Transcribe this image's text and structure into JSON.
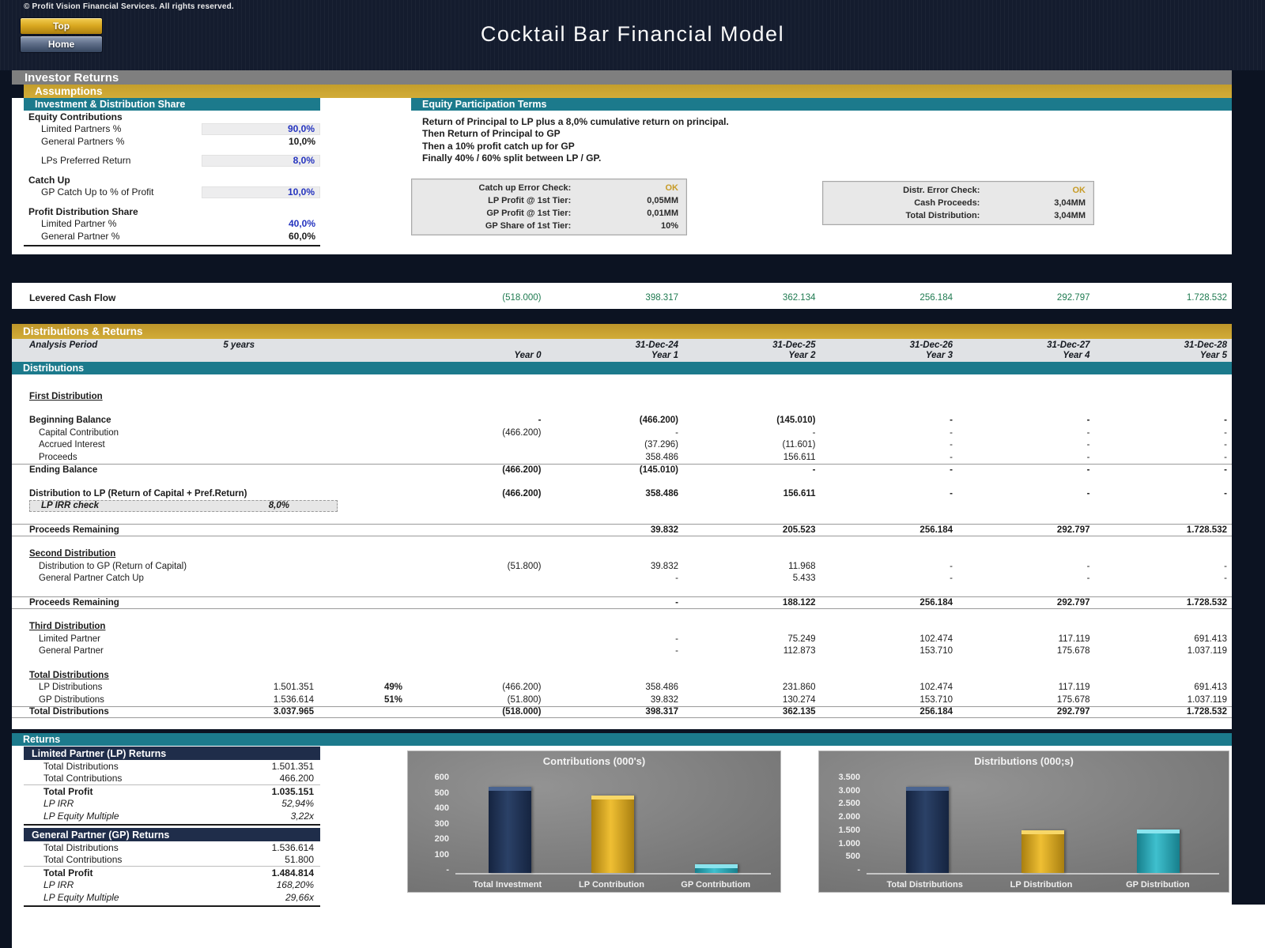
{
  "header": {
    "copyright": "© Profit Vision Financial Services. All rights reserved.",
    "top_button": "Top",
    "home_button": "Home",
    "title": "Cocktail Bar Financial Model"
  },
  "bars": {
    "investor_returns": "Investor Returns",
    "assumptions": "Assumptions",
    "distributions_returns": "Distributions & Returns",
    "distributions": "Distributions",
    "returns": "Returns"
  },
  "investment_share": {
    "title": "Investment & Distribution Share",
    "headings": [
      "Equity Contributions",
      "Catch Up",
      "Profit Distribution Share"
    ],
    "rows": [
      {
        "label": "Limited Partners %",
        "value": "90,0%"
      },
      {
        "label": "General Partners %",
        "value": "10,0%"
      },
      {
        "label": "LPs Preferred Return",
        "value": "8,0%"
      },
      {
        "label": "GP Catch Up to % of Profit",
        "value": "10,0%"
      },
      {
        "label": "Limited Partner %",
        "value": "40,0%"
      },
      {
        "label": "General Partner %",
        "value": "60,0%"
      }
    ]
  },
  "equity_terms": {
    "title": "Equity Participation Terms",
    "lines": [
      "Return of Principal to LP plus a 8,0% cumulative return on principal.",
      "Then Return of Principal to GP",
      "Then a 10% profit catch up for GP",
      "Finally 40% / 60% split between LP / GP."
    ],
    "catchup_check": {
      "rows": [
        {
          "label": "Catch up Error Check:",
          "value": "OK"
        },
        {
          "label": "LP Profit @ 1st Tier:",
          "value": "0,05MM"
        },
        {
          "label": "GP Profit @ 1st Tier:",
          "value": "0,01MM"
        },
        {
          "label": "GP Share of 1st Tier:",
          "value": "10%"
        }
      ]
    },
    "distr_check": {
      "rows": [
        {
          "label": "Distr. Error Check:",
          "value": "OK"
        },
        {
          "label": "Cash Proceeds:",
          "value": "3,04MM"
        },
        {
          "label": "Total Distribution:",
          "value": "3,04MM"
        }
      ]
    }
  },
  "levered": {
    "label": "Levered Cash Flow",
    "values": [
      "(518.000)",
      "398.317",
      "362.134",
      "256.184",
      "292.797",
      "1.728.532"
    ]
  },
  "periods": {
    "analysis_label": "Analysis Period",
    "analysis_value": "5 years",
    "dates": [
      "31-Dec-24",
      "31-Dec-25",
      "31-Dec-26",
      "31-Dec-27",
      "31-Dec-28"
    ],
    "year_labels": [
      "Year 0",
      "Year 1",
      "Year 2",
      "Year 3",
      "Year 4",
      "Year 5"
    ]
  },
  "dist_table": {
    "rows": [
      {
        "type": "spacer",
        "lg": true
      },
      {
        "label": "First Distribution",
        "b": true,
        "u": true
      },
      {
        "type": "spacer"
      },
      {
        "label": "Beginning Balance",
        "b": true,
        "v": [
          "-",
          "(466.200)",
          "(145.010)",
          "-",
          "-",
          "-"
        ]
      },
      {
        "label": "Capital Contribution",
        "i": true,
        "v": [
          "(466.200)",
          "-",
          "-",
          "-",
          "-",
          "-"
        ]
      },
      {
        "label": "Accrued Interest",
        "i": true,
        "v": [
          "",
          "(37.296)",
          "(11.601)",
          "-",
          "-",
          "-"
        ]
      },
      {
        "label": "Proceeds",
        "i": true,
        "v": [
          "",
          "358.486",
          "156.611",
          "-",
          "-",
          "-"
        ]
      },
      {
        "label": "Ending Balance",
        "b": true,
        "border": "top",
        "v": [
          "(466.200)",
          "(145.010)",
          "-",
          "-",
          "-",
          "-"
        ]
      },
      {
        "type": "spacer"
      },
      {
        "label": "Distribution to LP (Return of Capital + Pref.Return)",
        "b": true,
        "v": [
          "(466.200)",
          "358.486",
          "156.611",
          "-",
          "-",
          "-"
        ]
      },
      {
        "label": "LP IRR check",
        "irr": true,
        "pct": "8,0%"
      },
      {
        "type": "spacer"
      },
      {
        "label": "Proceeds Remaining",
        "b": true,
        "border": "both",
        "v": [
          "",
          "39.832",
          "205.523",
          "256.184",
          "292.797",
          "1.728.532"
        ]
      },
      {
        "type": "spacer"
      },
      {
        "label": "Second Distribution",
        "b": true,
        "u": true
      },
      {
        "label": "Distribution to GP (Return of Capital)",
        "i": true,
        "v": [
          "(51.800)",
          "39.832",
          "11.968",
          "-",
          "-",
          "-"
        ]
      },
      {
        "label": "General Partner Catch Up",
        "i": true,
        "v": [
          "",
          "-",
          "5.433",
          "-",
          "-",
          "-"
        ]
      },
      {
        "type": "spacer"
      },
      {
        "label": "Proceeds Remaining",
        "b": true,
        "border": "both",
        "v": [
          "",
          "-",
          "188.122",
          "256.184",
          "292.797",
          "1.728.532"
        ]
      },
      {
        "type": "spacer"
      },
      {
        "label": "Third Distribution",
        "b": true,
        "u": true
      },
      {
        "label": "Limited Partner",
        "i": true,
        "v": [
          "",
          "-",
          "75.249",
          "102.474",
          "117.119",
          "691.413"
        ]
      },
      {
        "label": "General Partner",
        "i": true,
        "v": [
          "",
          "-",
          "112.873",
          "153.710",
          "175.678",
          "1.037.119"
        ]
      },
      {
        "type": "spacer"
      },
      {
        "label": "Total Distributions",
        "b": true,
        "u": true
      },
      {
        "label": "LP Distributions",
        "i": true,
        "total": "1.501.351",
        "pct": "49%",
        "v": [
          "(466.200)",
          "358.486",
          "231.860",
          "102.474",
          "117.119",
          "691.413"
        ]
      },
      {
        "label": "GP Distributions",
        "i": true,
        "total": "1.536.614",
        "pct": "51%",
        "v": [
          "(51.800)",
          "39.832",
          "130.274",
          "153.710",
          "175.678",
          "1.037.119"
        ]
      },
      {
        "label": "Total Distributions",
        "b": true,
        "total": "3.037.965",
        "border": "both",
        "v": [
          "(518.000)",
          "398.317",
          "362.135",
          "256.184",
          "292.797",
          "1.728.532"
        ]
      }
    ]
  },
  "returns_panels": {
    "lp": {
      "title": "Limited Partner (LP) Returns",
      "rows": [
        {
          "label": "Total Distributions",
          "value": "1.501.351"
        },
        {
          "label": "Total Contributions",
          "value": "466.200"
        },
        {
          "label": "Total Profit",
          "value": "1.035.151"
        },
        {
          "label": "LP IRR",
          "value": "52,94%"
        },
        {
          "label": "LP Equity Multiple",
          "value": "3,22x"
        }
      ]
    },
    "gp": {
      "title": "General Partner (GP) Returns",
      "rows": [
        {
          "label": "Total Distributions",
          "value": "1.536.614"
        },
        {
          "label": "Total Contributions",
          "value": "51.800"
        },
        {
          "label": "Total Profit",
          "value": "1.484.814"
        },
        {
          "label": "LP IRR",
          "value": "168,20%"
        },
        {
          "label": "LP Equity Multiple",
          "value": "29,66x"
        }
      ]
    }
  },
  "chart_data": [
    {
      "type": "bar",
      "title": "Contributions (000's)",
      "categories": [
        "Total Investment",
        "LP Contribution",
        "GP Contributiom"
      ],
      "values": [
        518,
        466,
        52
      ],
      "ylim": [
        0,
        600
      ],
      "yticks": [
        "600",
        "500",
        "400",
        "300",
        "200",
        "100",
        "-"
      ],
      "bar_colors": [
        {
          "main": "#2B4167",
          "edge": "#152440",
          "lid": "#4A6490"
        },
        {
          "main": "#EFBF33",
          "edge": "#A97F10",
          "lid": "#F7D768"
        },
        {
          "main": "#3FC0CE",
          "edge": "#177F8C",
          "lid": "#8AE4EE"
        }
      ],
      "grid": false,
      "legend": false
    },
    {
      "type": "bar",
      "title": "Distributions (000;s)",
      "categories": [
        "Total Distributions",
        "LP Distribution",
        "GP Distribution"
      ],
      "values": [
        3038,
        1501,
        1537
      ],
      "ylim": [
        0,
        3500
      ],
      "yticks": [
        "3.500",
        "3.000",
        "2.500",
        "2.000",
        "1.500",
        "1.000",
        "500",
        "-"
      ],
      "bar_colors": [
        {
          "main": "#2B4167",
          "edge": "#152440",
          "lid": "#4A6490"
        },
        {
          "main": "#EFBF33",
          "edge": "#A97F10",
          "lid": "#F7D768"
        },
        {
          "main": "#3FC0CE",
          "edge": "#177F8C",
          "lid": "#8AE4EE"
        }
      ],
      "grid": false,
      "legend": false
    }
  ]
}
